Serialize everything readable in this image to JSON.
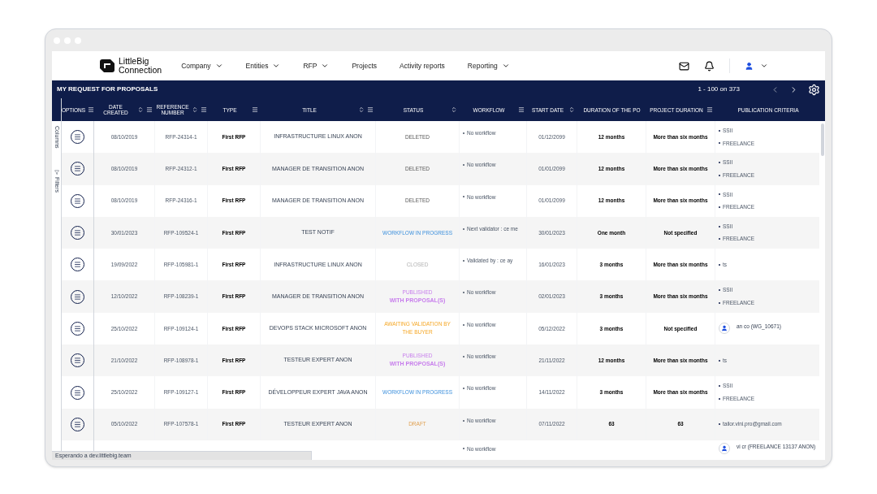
{
  "brand": {
    "line1": "LittleBig",
    "line2": "Connection"
  },
  "nav": [
    {
      "label": "Company",
      "dropdown": true
    },
    {
      "label": "Entities",
      "dropdown": true
    },
    {
      "label": "RFP",
      "dropdown": true
    },
    {
      "label": "Projects",
      "dropdown": false
    },
    {
      "label": "Activity reports",
      "dropdown": false
    },
    {
      "label": "Reporting",
      "dropdown": true
    }
  ],
  "title_bar": {
    "title": "MY REQUEST FOR PROPOSALS",
    "pagination": "1 - 100 on 373",
    "prev_disabled": true,
    "next_disabled": false
  },
  "side_tabs": [
    "Columns",
    "Filters"
  ],
  "table": {
    "columns": [
      {
        "label": "OPTIONS",
        "sortable": false,
        "menu": true
      },
      {
        "label": "DATE CREATED",
        "sortable": true,
        "menu": true
      },
      {
        "label": "REFERENCE NUMBER",
        "sortable": true,
        "menu": true
      },
      {
        "label": "TYPE",
        "sortable": false,
        "menu": true
      },
      {
        "label": "TITLE",
        "sortable": true,
        "menu": true
      },
      {
        "label": "STATUS",
        "sortable": true,
        "menu": false
      },
      {
        "label": "WORKFLOW",
        "sortable": false,
        "menu": true
      },
      {
        "label": "START DATE",
        "sortable": true,
        "menu": false
      },
      {
        "label": "DURATION OF THE PO",
        "sortable": false,
        "menu": false
      },
      {
        "label": "PROJECT DURATION",
        "sortable": false,
        "menu": true
      },
      {
        "label": "PUBLICATION CRITERIA",
        "sortable": false,
        "menu": false
      }
    ],
    "rows": [
      {
        "date": "08/10/2019",
        "ref": "RFP-24314-1",
        "type": "First RFP",
        "title": "INFRASTRUCTURE LINUX ANON",
        "status": {
          "label": "DELETED",
          "kind": "deleted"
        },
        "workflow": "No workflow",
        "start": "01/12/2099",
        "duration": "12 months",
        "project": "More than six months",
        "criteria": [
          {
            "kind": "bullet",
            "text": "SSII"
          },
          {
            "kind": "bullet",
            "text": "FREELANCE"
          }
        ]
      },
      {
        "date": "08/10/2019",
        "ref": "RFP-24312-1",
        "type": "First RFP",
        "title": "MANAGER DE TRANSITION ANON",
        "status": {
          "label": "DELETED",
          "kind": "deleted"
        },
        "workflow": "No workflow",
        "start": "01/01/2099",
        "duration": "12 months",
        "project": "More than six months",
        "criteria": [
          {
            "kind": "bullet",
            "text": "SSII"
          },
          {
            "kind": "bullet",
            "text": "FREELANCE"
          }
        ]
      },
      {
        "date": "08/10/2019",
        "ref": "RFP-24316-1",
        "type": "First RFP",
        "title": "MANAGER DE TRANSITION ANON",
        "status": {
          "label": "DELETED",
          "kind": "deleted"
        },
        "workflow": "No workflow",
        "start": "01/01/2099",
        "duration": "12 months",
        "project": "More than six months",
        "criteria": [
          {
            "kind": "bullet",
            "text": "SSII"
          },
          {
            "kind": "bullet",
            "text": "FREELANCE"
          }
        ]
      },
      {
        "date": "30/01/2023",
        "ref": "RFP-109524-1",
        "type": "First RFP",
        "title": "TEST NOTIF",
        "status": {
          "label": "WORKFLOW IN PROGRESS",
          "kind": "in_progress"
        },
        "workflow": "Next validator : ce me",
        "start": "30/01/2023",
        "duration": "One month",
        "project": "Not specified",
        "criteria": [
          {
            "kind": "bullet",
            "text": "SSII"
          },
          {
            "kind": "bullet",
            "text": "FREELANCE"
          }
        ]
      },
      {
        "date": "19/09/2022",
        "ref": "RFP-105981-1",
        "type": "First RFP",
        "title": "INFRASTRUCTURE LINUX ANON",
        "status": {
          "label": "CLOSED",
          "kind": "closed"
        },
        "workflow": "Validated by : ce ay",
        "start": "16/01/2023",
        "duration": "3 months",
        "project": "More than six months",
        "criteria": [
          {
            "kind": "bullet",
            "text": "ts"
          }
        ]
      },
      {
        "date": "12/10/2022",
        "ref": "RFP-108239-1",
        "type": "First RFP",
        "title": "MANAGER DE TRANSITION ANON",
        "status": {
          "label": "PUBLISHED",
          "sub": "WITH PROPOSAL(S)",
          "kind": "published"
        },
        "workflow": "No workflow",
        "start": "02/01/2023",
        "duration": "3 months",
        "project": "More than six months",
        "criteria": [
          {
            "kind": "bullet",
            "text": "SSII"
          },
          {
            "kind": "bullet",
            "text": "FREELANCE"
          }
        ]
      },
      {
        "date": "25/10/2022",
        "ref": "RFP-109124-1",
        "type": "First RFP",
        "title": "DEVOPS STACK MICROSOFT ANON",
        "status": {
          "label": "AWAITING VALIDATION BY THE BUYER",
          "kind": "awaiting"
        },
        "workflow": "No workflow",
        "start": "05/12/2022",
        "duration": "3 months",
        "project": "Not specified",
        "criteria": [
          {
            "kind": "person",
            "text": "an co (WG_10671)"
          }
        ]
      },
      {
        "date": "21/10/2022",
        "ref": "RFP-108978-1",
        "type": "First RFP",
        "title": "TESTEUR EXPERT ANON",
        "status": {
          "label": "PUBLISHED",
          "sub": "WITH PROPOSAL(S)",
          "kind": "published"
        },
        "workflow": "No workflow",
        "start": "21/11/2022",
        "duration": "12 months",
        "project": "More than six months",
        "criteria": [
          {
            "kind": "bullet",
            "text": "ts"
          }
        ]
      },
      {
        "date": "25/10/2022",
        "ref": "RFP-109127-1",
        "type": "First RFP",
        "title": "DÉVELOPPEUR EXPERT JAVA ANON",
        "status": {
          "label": "WORKFLOW IN PROGRESS",
          "kind": "in_progress"
        },
        "workflow": "No workflow",
        "start": "14/11/2022",
        "duration": "3 months",
        "project": "More than six months",
        "criteria": [
          {
            "kind": "bullet",
            "text": "SSII"
          },
          {
            "kind": "bullet",
            "text": "FREELANCE"
          }
        ]
      },
      {
        "date": "05/10/2022",
        "ref": "RFP-107578-1",
        "type": "First RFP",
        "title": "TESTEUR EXPERT ANON",
        "status": {
          "label": "DRAFT",
          "kind": "draft"
        },
        "workflow": "No workflow",
        "start": "07/11/2022",
        "duration": "63",
        "project": "63",
        "criteria": [
          {
            "kind": "bullet",
            "text": "tailor.vini.pro@gmail.com"
          }
        ]
      }
    ],
    "partial_row": {
      "workflow": "No workflow",
      "criteria": [
        {
          "kind": "person",
          "text": "vi cr (FREELANCE 13137 ANON)"
        }
      ]
    }
  },
  "status_bar": "Esperando a dev.littlebig.team"
}
